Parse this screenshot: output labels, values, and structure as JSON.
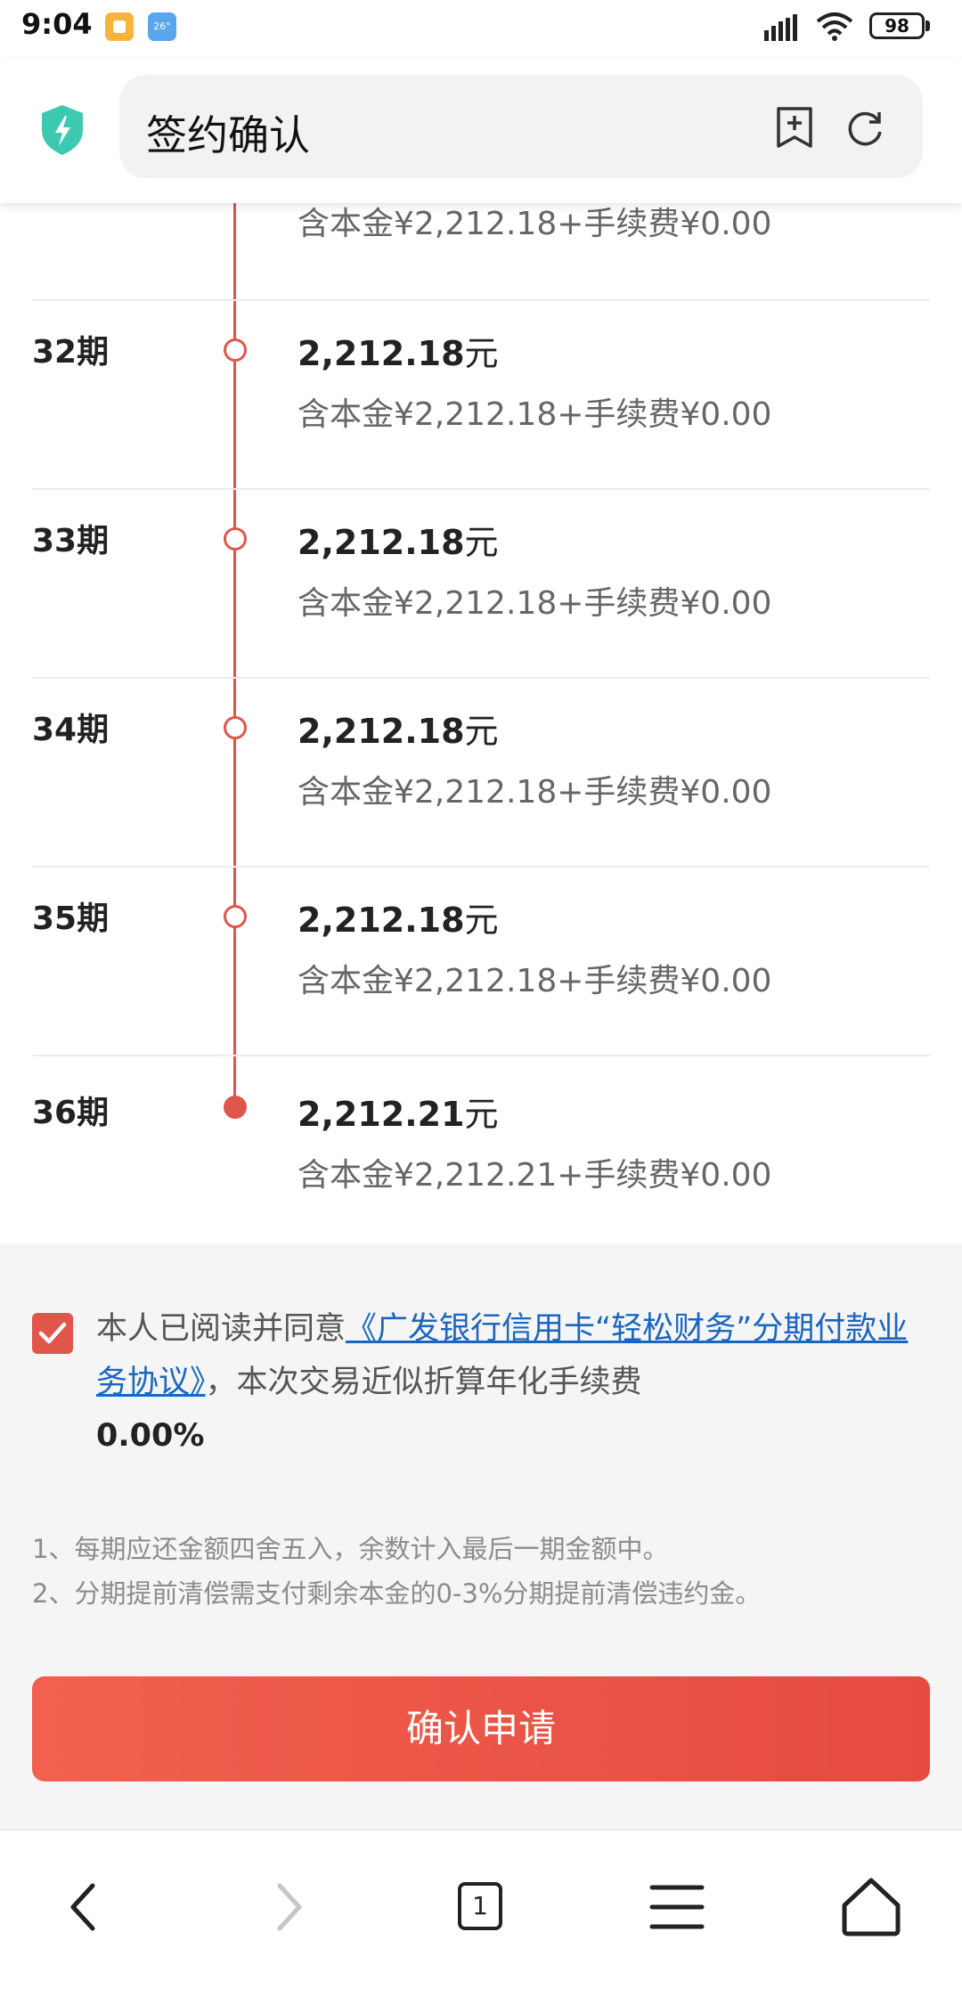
{
  "status_bar": {
    "time": "9:04",
    "weather_icon_text": "26°",
    "battery": "98"
  },
  "header": {
    "title": "签约确认"
  },
  "partial_row": {
    "detail": "含本金¥2,212.18+手续费¥0.00"
  },
  "schedule": [
    {
      "period": "32期",
      "amount": "2,212.18",
      "unit": "元",
      "detail": "含本金¥2,212.18+手续费¥0.00",
      "current": false
    },
    {
      "period": "33期",
      "amount": "2,212.18",
      "unit": "元",
      "detail": "含本金¥2,212.18+手续费¥0.00",
      "current": false
    },
    {
      "period": "34期",
      "amount": "2,212.18",
      "unit": "元",
      "detail": "含本金¥2,212.18+手续费¥0.00",
      "current": false
    },
    {
      "period": "35期",
      "amount": "2,212.18",
      "unit": "元",
      "detail": "含本金¥2,212.18+手续费¥0.00",
      "current": false
    },
    {
      "period": "36期",
      "amount": "2,212.21",
      "unit": "元",
      "detail": "含本金¥2,212.21+手续费¥0.00",
      "current": true
    }
  ],
  "agreement": {
    "checked": true,
    "prefix": "本人已阅读并同意",
    "link": "《广发银行信用卡“轻松财务”分期付款业务协议》",
    "suffix": "，本次交易近似折算年化手续费",
    "rate": "0.00%"
  },
  "notes": [
    "1、每期应还金额四舍五入，余数计入最后一期金额中。",
    "2、分期提前清偿需支付剩余本金的0-3%分期提前清偿违约金。"
  ],
  "confirm_button": "确认申请",
  "bottom_nav": {
    "tab_count": "1"
  },
  "colors": {
    "accent": "#e1564b",
    "link": "#1a66c2"
  }
}
